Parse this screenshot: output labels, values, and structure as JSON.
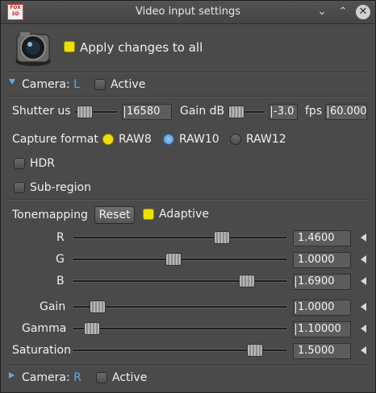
{
  "window": {
    "title": "Video input settings",
    "app_logo_text": "FOX 3D"
  },
  "header": {
    "apply_all": {
      "label": "Apply changes to all",
      "checked": true
    }
  },
  "camera_left": {
    "label": "Camera:",
    "id": "L",
    "active_label": "Active",
    "expanded": true
  },
  "exposure": {
    "shutter": {
      "label": "Shutter us",
      "value": "16580",
      "level": 0.2
    },
    "gain": {
      "label": "Gain dB",
      "value": "-3.0",
      "level": 0.1
    },
    "fps": {
      "label": "fps",
      "value": "60.000"
    }
  },
  "capture": {
    "label": "Capture format",
    "options": [
      {
        "label": "RAW8",
        "state": "yellow"
      },
      {
        "label": "RAW10",
        "state": "blue"
      },
      {
        "label": "RAW12",
        "state": "off"
      }
    ]
  },
  "hdr": {
    "label": "HDR",
    "checked": false
  },
  "subregion": {
    "label": "Sub-region",
    "checked": false
  },
  "tonemapping": {
    "label": "Tonemapping",
    "reset_label": "Reset",
    "adaptive": {
      "label": "Adaptive",
      "checked": true
    },
    "sliders": [
      {
        "label": "R",
        "value": "1.4600"
      },
      {
        "label": "G",
        "value": "1.0000"
      },
      {
        "label": "B",
        "value": "1.6900"
      },
      {
        "label": "Gain",
        "value": "1.0000"
      },
      {
        "label": "Gamma",
        "value": "1.10000"
      },
      {
        "label": "Saturation",
        "value": "1.5000"
      }
    ]
  },
  "camera_right": {
    "label": "Camera:",
    "id": "R",
    "active_label": "Active",
    "expanded": false
  },
  "colors": {
    "accent_blue": "#5aaaf0",
    "check_yellow": "#f0e000"
  }
}
